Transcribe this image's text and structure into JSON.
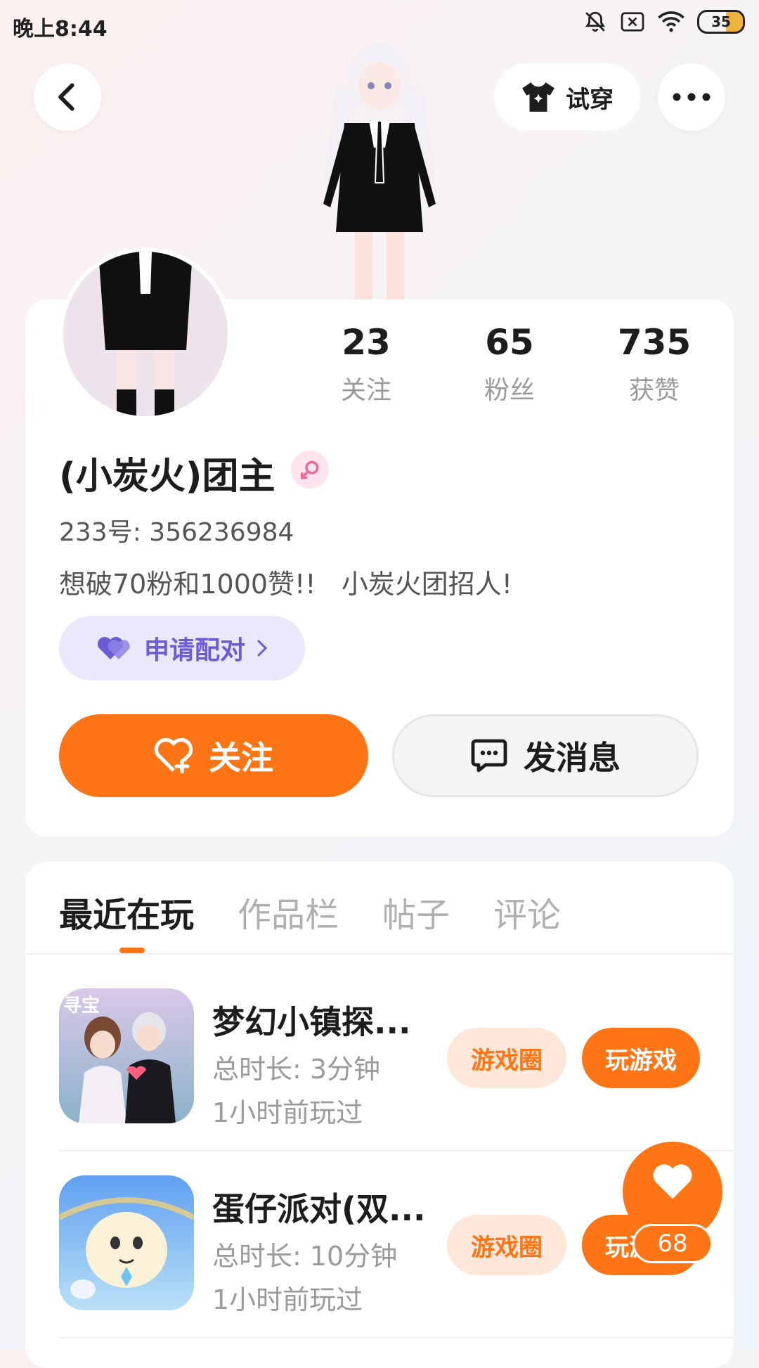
{
  "status": {
    "time": "晚上8:44",
    "battery": "35"
  },
  "header": {
    "try_on_label": "试穿"
  },
  "stats": [
    {
      "value": "23",
      "label": "关注"
    },
    {
      "value": "65",
      "label": "粉丝"
    },
    {
      "value": "735",
      "label": "获赞"
    }
  ],
  "profile": {
    "name": "(小炭火)团主",
    "uid": "233号: 356236984",
    "bio": "想破70粉和1000赞!!   小炭火团招人!",
    "pair_label": "申请配对"
  },
  "actions": {
    "follow_label": "关注",
    "message_label": "发消息"
  },
  "tabs": [
    "最近在玩",
    "作品栏",
    "帖子",
    "评论"
  ],
  "games": [
    {
      "title": "梦幻小镇探...",
      "duration": "总时长: 3分钟",
      "last_played": "1小时前玩过",
      "icon_badge": "寻宝",
      "circle_label": "游戏圈",
      "play_label": "玩游戏"
    },
    {
      "title": "蛋仔派对(双...",
      "duration": "总时长: 10分钟",
      "last_played": "1小时前玩过",
      "circle_label": "游戏圈",
      "play_label": "玩游戏"
    }
  ],
  "floating_like": {
    "count": "68"
  },
  "colors": {
    "accent": "#ff7414",
    "pair_bg": "#ebe8fb",
    "pair_text": "#6a5bd6"
  }
}
